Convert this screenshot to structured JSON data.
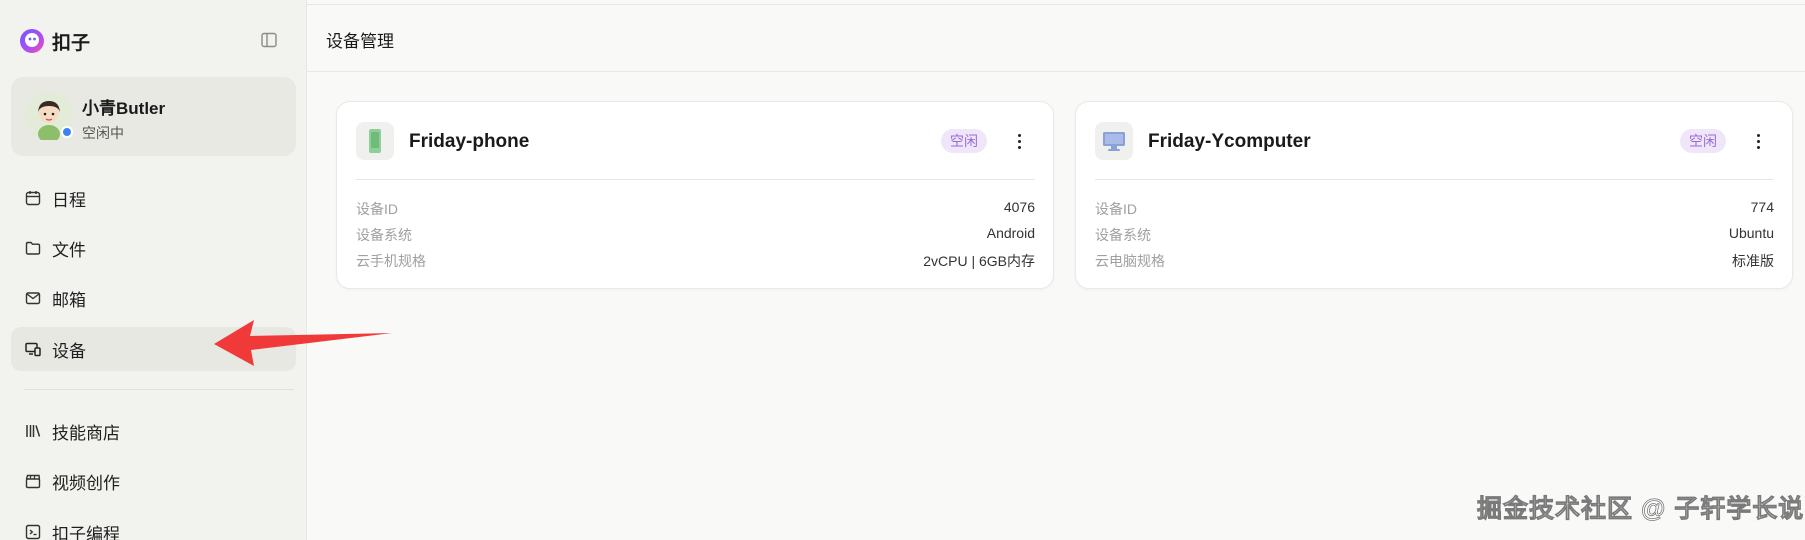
{
  "brand": {
    "name": "扣子"
  },
  "profile": {
    "name": "小青Butler",
    "status": "空闲中"
  },
  "sidebar": {
    "items": [
      {
        "label": "日程",
        "icon": "calendar-icon"
      },
      {
        "label": "文件",
        "icon": "folder-icon"
      },
      {
        "label": "邮箱",
        "icon": "mail-icon"
      },
      {
        "label": "设备",
        "icon": "devices-icon",
        "active": true
      },
      {
        "label": "技能商店",
        "icon": "library-icon"
      },
      {
        "label": "视频创作",
        "icon": "clapperboard-icon"
      },
      {
        "label": "扣子编程",
        "icon": "code-icon"
      }
    ]
  },
  "page": {
    "title": "设备管理"
  },
  "devices": [
    {
      "name": "Friday-phone",
      "icon": "phone-icon",
      "status": "空闲",
      "rows": [
        {
          "key": "设备ID",
          "value": "4076"
        },
        {
          "key": "设备系统",
          "value": "Android"
        },
        {
          "key": "云手机规格",
          "value": "2vCPU | 6GB内存"
        }
      ]
    },
    {
      "name": "Friday-Ycomputer",
      "icon": "monitor-icon",
      "status": "空闲",
      "rows": [
        {
          "key": "设备ID",
          "value": "774"
        },
        {
          "key": "设备系统",
          "value": "Ubuntu"
        },
        {
          "key": "云电脑规格",
          "value": "标准版"
        }
      ]
    }
  ],
  "watermark": "掘金技术社区 @ 子轩学长说",
  "colors": {
    "badge_bg": "#efe6fa",
    "badge_text": "#9b6ad6",
    "arrow": "#f03a3a",
    "status_dot": "#3b82f6"
  }
}
